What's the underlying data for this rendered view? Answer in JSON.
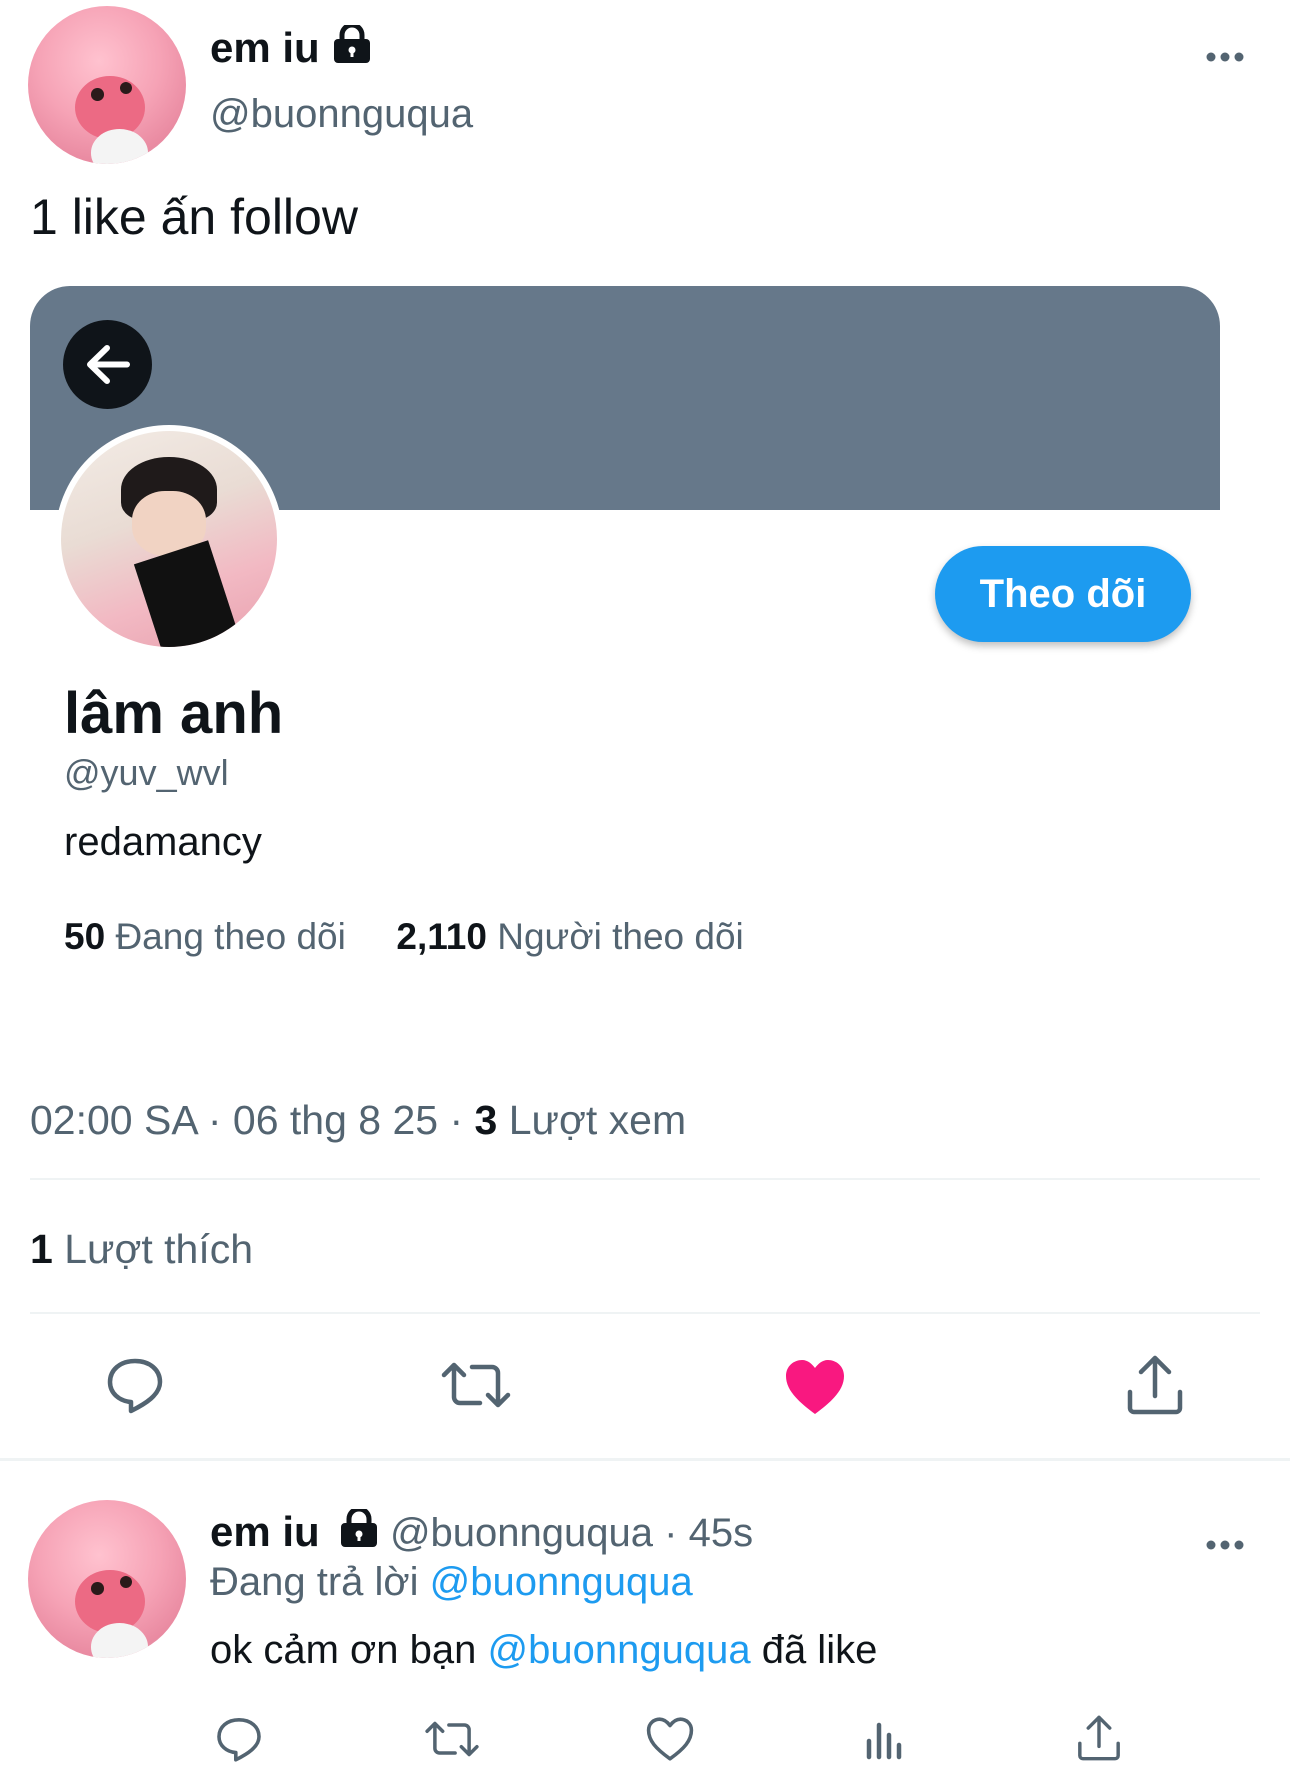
{
  "main_tweet": {
    "author_name": "em iu",
    "author_handle": "@buonnguqua",
    "text": "1 like ấn follow",
    "embedded_profile": {
      "follow_label": "Theo dõi",
      "name": "lâm anh",
      "handle": "@yuv_wvl",
      "bio": "redamancy",
      "following_count": "50",
      "following_label": "Đang theo dõi",
      "followers_count": "2,110",
      "followers_label": "Người theo dõi"
    },
    "time": "02:00 SA",
    "date": "06 thg 8 25",
    "views_count": "3",
    "views_label": "Lượt xem",
    "likes_count": "1",
    "likes_label": "Lượt thích"
  },
  "reply": {
    "author_name": "em iu",
    "author_handle": "@buonnguqua",
    "age": "45s",
    "replying_label": "Đang trả lời",
    "replying_handle": "@buonnguqua",
    "text_before": "ok cảm ơn bạn",
    "mention": "@buonnguqua",
    "text_after": "đã like"
  },
  "colors": {
    "accent": "#1d9bf0",
    "like": "#f91880",
    "banner": "#66788a",
    "muted": "#536471"
  },
  "icons": {
    "reply": "reply-icon",
    "retweet": "retweet-icon",
    "like": "heart-icon",
    "share": "share-icon",
    "views": "views-icon",
    "more": "more-icon",
    "lock": "lock-icon",
    "back": "back-arrow-icon"
  }
}
